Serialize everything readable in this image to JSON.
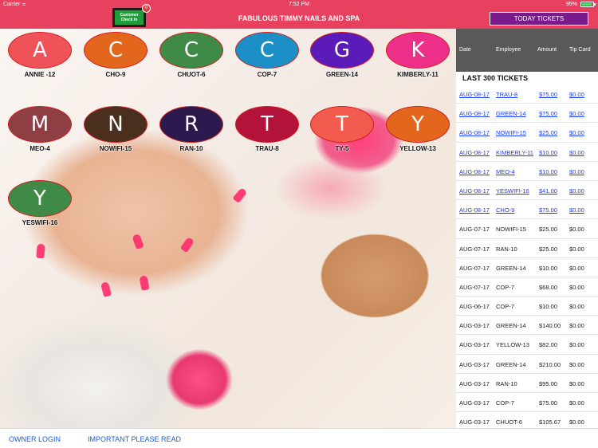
{
  "status": {
    "carrier": "Carrier",
    "wifi_icon": "wifi-icon",
    "time": "7:52 PM",
    "battery": "95%",
    "battery_level": 0.95
  },
  "header": {
    "title": "FABULOUS TIMMY NAILS AND SPA",
    "checkin_label": "Customer Check In",
    "checkin_badge": "0",
    "today_button": "TODAY TICKETS"
  },
  "employees": [
    {
      "letter": "A",
      "name": "ANNIE -12",
      "color": "#f0525a"
    },
    {
      "letter": "C",
      "name": "CHO-9",
      "color": "#e2661c"
    },
    {
      "letter": "C",
      "name": "CHUOT-6",
      "color": "#3f8a46"
    },
    {
      "letter": "C",
      "name": "COP-7",
      "color": "#1c8fc7"
    },
    {
      "letter": "G",
      "name": "GREEN-14",
      "color": "#5b1bb8"
    },
    {
      "letter": "K",
      "name": "KIMBERLY-11",
      "color": "#ee2f8a"
    },
    {
      "letter": "M",
      "name": "MEO-4",
      "color": "#8f3f44"
    },
    {
      "letter": "N",
      "name": "NOWIFI-15",
      "color": "#4a2f1f"
    },
    {
      "letter": "R",
      "name": "RAN-10",
      "color": "#2c1a4f"
    },
    {
      "letter": "T",
      "name": "TRAU-8",
      "color": "#b3123a"
    },
    {
      "letter": "T",
      "name": "TY-5",
      "color": "#f25b4d"
    },
    {
      "letter": "Y",
      "name": "YELLOW-13",
      "color": "#e2661c"
    },
    {
      "letter": "Y",
      "name": "YESWIFI-16",
      "color": "#3f8a46"
    }
  ],
  "tickets": {
    "columns": [
      "Date",
      "Employee",
      "Amount",
      "Tip Card"
    ],
    "section_title": "LAST 300 TICKETS",
    "rows": [
      {
        "date": "AUG-08-17",
        "employee": "TRAU-8",
        "amount": "$75.00",
        "tip": "$0.00",
        "link": true
      },
      {
        "date": "AUG-08-17",
        "employee": "GREEN-14",
        "amount": "$75.00",
        "tip": "$0.00",
        "link": true
      },
      {
        "date": "AUG-08-17",
        "employee": "NOWIFI-15",
        "amount": "$25.00",
        "tip": "$0.00",
        "link": true
      },
      {
        "date": "AUG-08-17",
        "employee": "KIMBERLY-11",
        "amount": "$10.00",
        "tip": "$0.00",
        "link": true
      },
      {
        "date": "AUG-08-17",
        "employee": "MEO-4",
        "amount": "$10.00",
        "tip": "$0.00",
        "link": true
      },
      {
        "date": "AUG-08-17",
        "employee": "YESWIFI-16",
        "amount": "$41.00",
        "tip": "$0.00",
        "link": true
      },
      {
        "date": "AUG-08-17",
        "employee": "CHO-9",
        "amount": "$75.00",
        "tip": "$0.00",
        "link": true
      },
      {
        "date": "AUG-07-17",
        "employee": "NOWIFI-15",
        "amount": "$25.00",
        "tip": "$0.00",
        "link": false
      },
      {
        "date": "AUG-07-17",
        "employee": "RAN-10",
        "amount": "$25.00",
        "tip": "$0.00",
        "link": false
      },
      {
        "date": "AUG-07-17",
        "employee": "GREEN-14",
        "amount": "$10.00",
        "tip": "$0.00",
        "link": false
      },
      {
        "date": "AUG-07-17",
        "employee": "COP-7",
        "amount": "$68.00",
        "tip": "$0.00",
        "link": false
      },
      {
        "date": "AUG-06-17",
        "employee": "COP-7",
        "amount": "$10.00",
        "tip": "$0.00",
        "link": false
      },
      {
        "date": "AUG-03-17",
        "employee": "GREEN-14",
        "amount": "$140.00",
        "tip": "$0.00",
        "link": false
      },
      {
        "date": "AUG-03-17",
        "employee": "YELLOW-13",
        "amount": "$82.00",
        "tip": "$0.00",
        "link": false
      },
      {
        "date": "AUG-03-17",
        "employee": "GREEN-14",
        "amount": "$210.00",
        "tip": "$0.00",
        "link": false
      },
      {
        "date": "AUG-03-17",
        "employee": "RAN-10",
        "amount": "$95.00",
        "tip": "$0.00",
        "link": false
      },
      {
        "date": "AUG-03-17",
        "employee": "COP-7",
        "amount": "$75.00",
        "tip": "$0.00",
        "link": false
      },
      {
        "date": "AUG-03-17",
        "employee": "CHUOT-6",
        "amount": "$105.67",
        "tip": "$0.00",
        "link": false
      }
    ]
  },
  "footer": {
    "owner_login": "OWNER LOGIN",
    "important": "IMPORTANT PLEASE READ"
  }
}
